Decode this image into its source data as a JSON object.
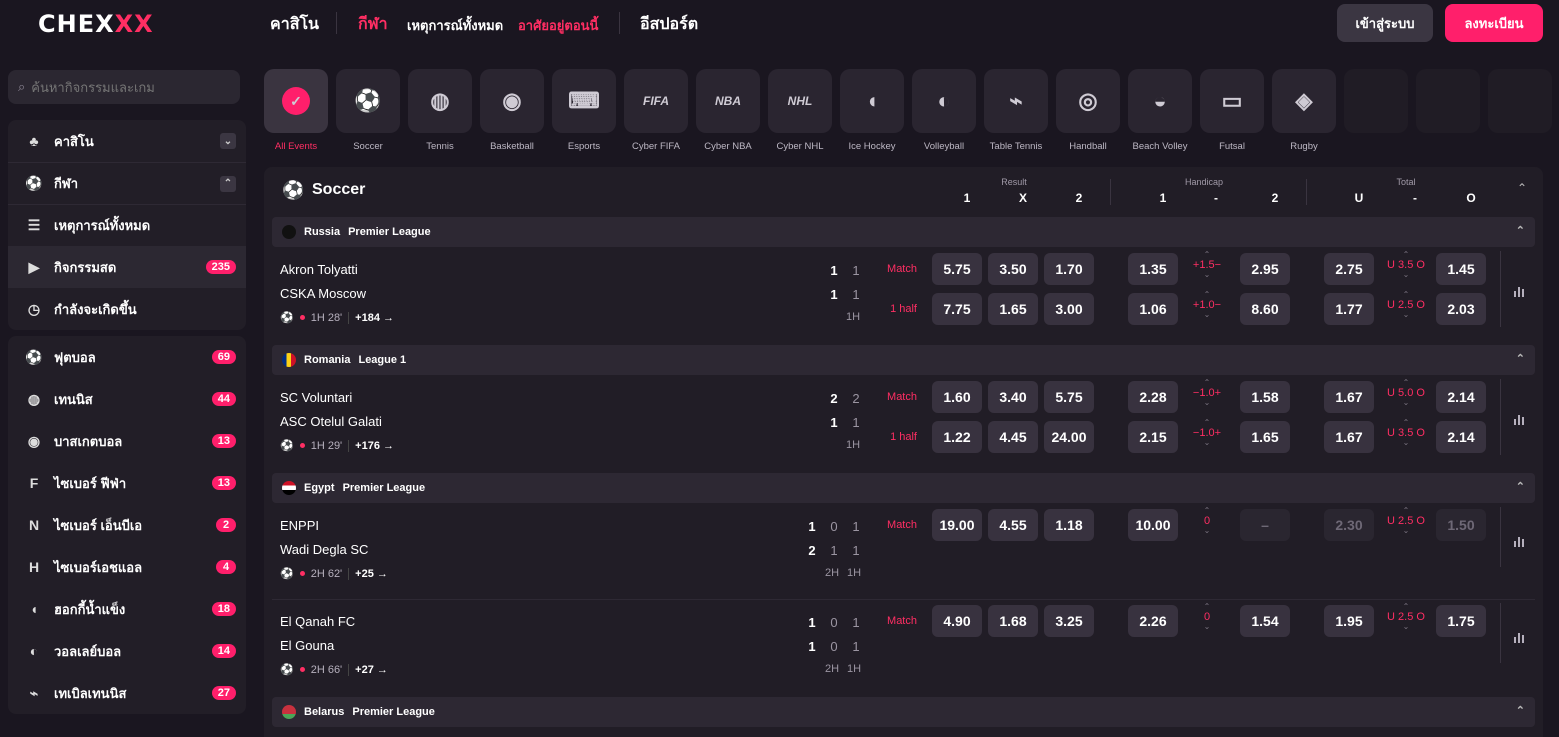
{
  "header": {
    "logo": "CHEXXX",
    "nav": [
      "คาสิโน",
      "กีฬา",
      "เหตุการณ์ทั้งหมด",
      "อาศัยอยู่ตอนนี้",
      "อีสปอร์ต"
    ],
    "login": "เข้าสู่ระบบ",
    "register": "ลงทะเบียน",
    "colors": {
      "accent": "#ff1f6b",
      "bg": "#1a1620"
    }
  },
  "sidebar": {
    "search_placeholder": "ค้นหากิจกรรมและเกม",
    "casino": "คาสิโน",
    "sport": "กีฬา",
    "items": [
      {
        "label": "เหตุการณ์ทั้งหมด",
        "icon": "list-icon"
      },
      {
        "label": "กิจกรรมสด",
        "count": "235",
        "icon": "play-icon"
      },
      {
        "label": "กำลังจะเกิดขึ้น",
        "icon": "clock-icon"
      }
    ],
    "sports": [
      {
        "label": "ฟุตบอล",
        "count": "69",
        "icon": "soccer-icon"
      },
      {
        "label": "เทนนิส",
        "count": "44",
        "icon": "tennis-icon"
      },
      {
        "label": "บาสเกตบอล",
        "count": "13",
        "icon": "basketball-icon"
      },
      {
        "label": "ไซเบอร์ ฟีฟ่า",
        "count": "13",
        "icon": "fifa-icon"
      },
      {
        "label": "ไซเบอร์ เอ็นบีเอ",
        "count": "2",
        "icon": "nba-icon"
      },
      {
        "label": "ไซเบอร์เอชแอล",
        "count": "4",
        "icon": "nhl-icon"
      },
      {
        "label": "ฮอกกี้น้ำแข็ง",
        "count": "18",
        "icon": "hockey-icon"
      },
      {
        "label": "วอลเลย์บอล",
        "count": "14",
        "icon": "volleyball-icon"
      },
      {
        "label": "เทเบิลเทนนิส",
        "count": "27",
        "icon": "table-tennis-icon"
      }
    ]
  },
  "categories": [
    "All Events",
    "Soccer",
    "Tennis",
    "Basketball",
    "Esports",
    "Cyber FIFA",
    "Cyber NBA",
    "Cyber NHL",
    "Ice Hockey",
    "Volleyball",
    "Table Tennis",
    "Handball",
    "Beach Volley",
    "Futsal",
    "Rugby"
  ],
  "category_icons": [
    "✓",
    "⚽",
    "◍",
    "◉",
    "⌨",
    "FIFA",
    "NBA",
    "NHL",
    "◖",
    "◐",
    "⌁",
    "◎",
    "◒",
    "▭",
    "◈"
  ],
  "section": {
    "title": "Soccer",
    "result": "Result",
    "handicap": "Handicap",
    "total": "Total",
    "cols": [
      "1",
      "X",
      "2",
      "1",
      "-",
      "2",
      "U",
      "-",
      "O"
    ]
  },
  "leagues": [
    {
      "country": "Russia",
      "name": "Premier League"
    },
    {
      "country": "Romania",
      "name": "League 1"
    },
    {
      "country": "Egypt",
      "name": "Premier League"
    },
    {
      "country": "Belarus",
      "name": "Premier League"
    }
  ],
  "events": [
    {
      "home": "Akron Tolyatti",
      "away": "CSKA Moscow",
      "hs": [
        "1",
        "1"
      ],
      "as": [
        "1",
        "1"
      ],
      "periods": [
        "1H"
      ],
      "time": "1H 28'",
      "more": "+184 →",
      "rows": [
        {
          "label": "Match",
          "r": [
            "5.75",
            "3.50",
            "1.70"
          ],
          "h1": "1.35",
          "hl": "+1.5−",
          "h2": "2.95",
          "u": "2.75",
          "tl": "U 3.5 O",
          "o": "1.45"
        },
        {
          "label": "1 half",
          "r": [
            "7.75",
            "1.65",
            "3.00"
          ],
          "h1": "1.06",
          "hl": "+1.0−",
          "h2": "8.60",
          "u": "1.77",
          "tl": "U 2.5 O",
          "o": "2.03"
        }
      ]
    },
    {
      "home": "SC Voluntari",
      "away": "ASC Otelul Galati",
      "hs": [
        "2",
        "2"
      ],
      "as": [
        "1",
        "1"
      ],
      "periods": [
        "1H"
      ],
      "time": "1H 29'",
      "more": "+176 →",
      "rows": [
        {
          "label": "Match",
          "r": [
            "1.60",
            "3.40",
            "5.75"
          ],
          "h1": "2.28",
          "hl": "−1.0+",
          "h2": "1.58",
          "u": "1.67",
          "tl": "U 5.0 O",
          "o": "2.14"
        },
        {
          "label": "1 half",
          "r": [
            "1.22",
            "4.45",
            "24.00"
          ],
          "h1": "2.15",
          "hl": "−1.0+",
          "h2": "1.65",
          "u": "1.67",
          "tl": "U 3.5 O",
          "o": "2.14"
        }
      ]
    },
    {
      "home": "ENPPI",
      "away": "Wadi Degla SC",
      "hs": [
        "1",
        "0",
        "1"
      ],
      "as": [
        "2",
        "1",
        "1"
      ],
      "periods": [
        "2H",
        "1H"
      ],
      "time": "2H 62'",
      "more": "+25 →",
      "rows": [
        {
          "label": "Match",
          "r": [
            "19.00",
            "4.55",
            "1.18"
          ],
          "h1": "10.00",
          "hl": "0",
          "h2": "–",
          "u": "2.30",
          "tl": "U 2.5 O",
          "o": "1.50"
        }
      ]
    },
    {
      "home": "El Qanah FC",
      "away": "El Gouna",
      "hs": [
        "1",
        "0",
        "1"
      ],
      "as": [
        "1",
        "0",
        "1"
      ],
      "periods": [
        "2H",
        "1H"
      ],
      "time": "2H 66'",
      "more": "+27 →",
      "rows": [
        {
          "label": "Match",
          "r": [
            "4.90",
            "1.68",
            "3.25"
          ],
          "h1": "2.26",
          "hl": "0",
          "h2": "1.54",
          "u": "1.95",
          "tl": "U 2.5 O",
          "o": "1.75"
        }
      ]
    }
  ]
}
